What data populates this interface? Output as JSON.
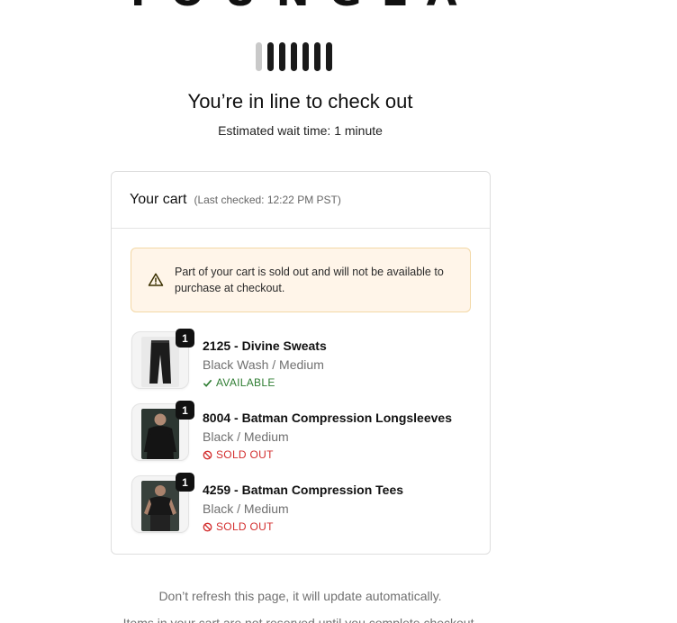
{
  "brand": {
    "logo_text": "YOUNGLA"
  },
  "queue": {
    "headline": "You’re in line to check out",
    "wait_time": "Estimated wait time: 1 minute"
  },
  "cart": {
    "title": "Your cart",
    "last_checked": "(Last checked: 12:22 PM PST)",
    "alert": "Part of your cart is sold out and will not be available to purchase at checkout.",
    "items": [
      {
        "qty": "1",
        "name": "2125 - Divine Sweats",
        "variant": "Black Wash / Medium",
        "status": "AVAILABLE",
        "status_type": "available",
        "image_icon": "black-sweatpants"
      },
      {
        "qty": "1",
        "name": "8004 - Batman Compression Longsleeves",
        "variant": "Black / Medium",
        "status": "SOLD OUT",
        "status_type": "sold-out",
        "image_icon": "man-black-longsleeve"
      },
      {
        "qty": "1",
        "name": "4259 - Batman Compression Tees",
        "variant": "Black / Medium",
        "status": "SOLD OUT",
        "status_type": "sold-out",
        "image_icon": "man-black-tee"
      }
    ]
  },
  "footer": {
    "refresh_note": "Don’t refresh this page, it will update automatically.",
    "reserve_note": "Items in your cart are not reserved until you complete checkout."
  },
  "colors": {
    "available": "#2e7d32",
    "sold_out": "#d32f2f",
    "alert_bg": "#fff5e9",
    "alert_border": "#f3d8a6"
  }
}
